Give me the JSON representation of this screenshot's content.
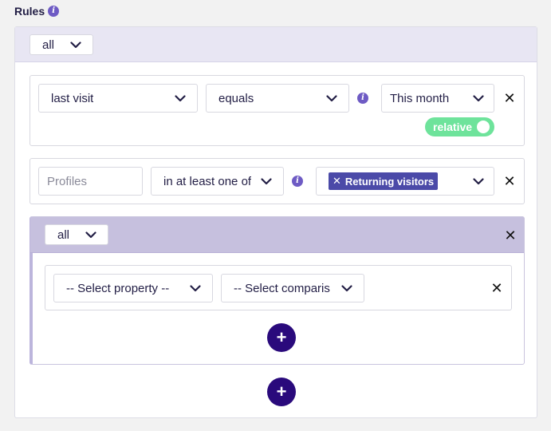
{
  "header": {
    "title": "Rules",
    "info_icon": "info-icon"
  },
  "root_group": {
    "match_select": "all",
    "rules": [
      {
        "property": "last visit",
        "comparison": "equals",
        "value": "This month",
        "toggle_label": "relative",
        "toggle_on": true
      },
      {
        "property_placeholder": "Profiles",
        "comparison": "in at least one of",
        "tags": [
          "Returning visitors"
        ]
      }
    ],
    "nested_group": {
      "match_select": "all",
      "rule": {
        "property": "-- Select property --",
        "comparison": "-- Select comparis"
      }
    }
  },
  "icons": {
    "close": "close-icon",
    "add": "plus-icon",
    "chevron": "chevron-down-icon",
    "info": "info-icon"
  },
  "colors": {
    "accent": "#6e5bc4",
    "add_button": "#2a0a7c",
    "toggle": "#6ee39b",
    "tag": "#4b4aa8",
    "group_header": "#c6c0de"
  }
}
